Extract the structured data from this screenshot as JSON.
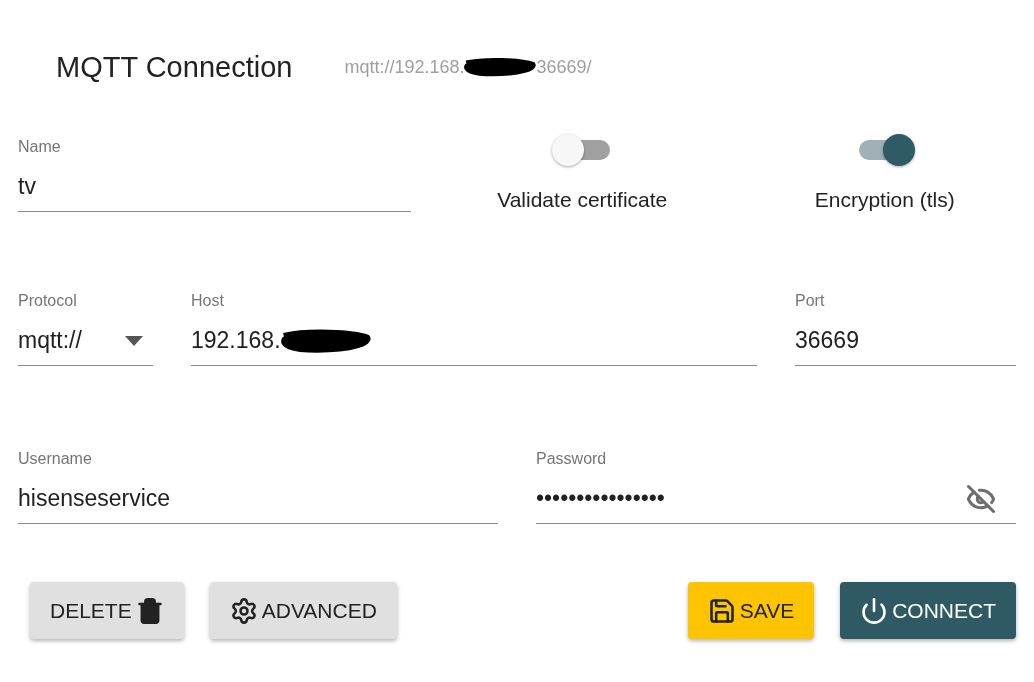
{
  "header": {
    "title": "MQTT Connection",
    "url_start": "mqtt://192.168.",
    "url_end": "36669/"
  },
  "name": {
    "label": "Name",
    "value": "tv"
  },
  "toggles": [
    {
      "label": "Validate certificate",
      "on": false
    },
    {
      "label": "Encryption (tls)",
      "on": true
    }
  ],
  "protocol": {
    "label": "Protocol",
    "value": "mqtt://"
  },
  "host": {
    "label": "Host",
    "value": "192.168."
  },
  "port": {
    "label": "Port",
    "value": "36669"
  },
  "username": {
    "label": "Username",
    "value": "hisenseservice"
  },
  "password": {
    "label": "Password",
    "value": "••••••••••••••••"
  },
  "buttons": [
    {
      "kind": "delete",
      "label": "DELETE"
    },
    {
      "kind": "advanced",
      "label": "ADVANCED"
    },
    {
      "kind": "save",
      "label": "SAVE"
    },
    {
      "kind": "connect",
      "label": "CONNECT"
    }
  ]
}
